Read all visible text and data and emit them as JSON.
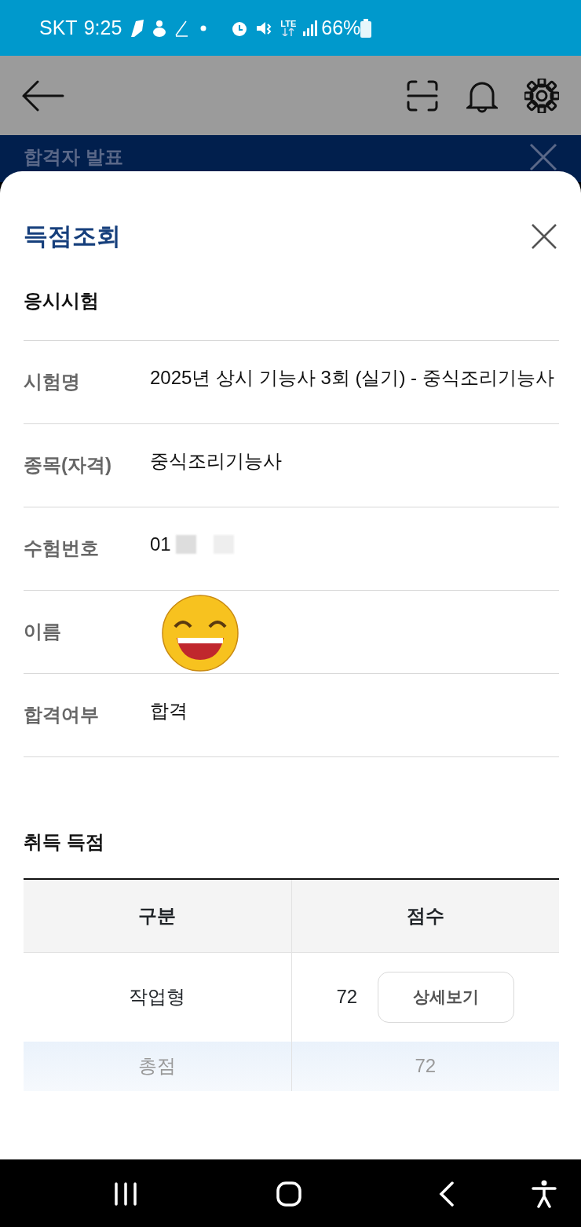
{
  "status_bar": {
    "carrier": "SKT",
    "time": "9:25",
    "network": "LTE",
    "battery": "66%"
  },
  "app_bar": {
    "behind_title": "합격자 발표"
  },
  "sheet": {
    "title": "득점조회",
    "exam_section": {
      "heading": "응시시험",
      "fields": [
        {
          "label": "시험명",
          "value": "2025년 상시 기능사 3회 (실기) - 중식조리기능사",
          "kind": "text"
        },
        {
          "label": "종목(자격)",
          "value": "중식조리기능사",
          "kind": "text"
        },
        {
          "label": "수험번호",
          "value": "01",
          "kind": "redacted"
        },
        {
          "label": "이름",
          "kind": "sticker"
        },
        {
          "label": "합격여부",
          "value": "합격",
          "kind": "text"
        }
      ]
    },
    "score_section": {
      "heading": "취득 득점",
      "table": {
        "columns": [
          "구분",
          "점수"
        ],
        "rows": [
          {
            "kind": "item",
            "category": "작업형",
            "score": "72",
            "button": "상세보기"
          },
          {
            "kind": "total",
            "category": "총점",
            "score": "72"
          }
        ]
      }
    }
  }
}
